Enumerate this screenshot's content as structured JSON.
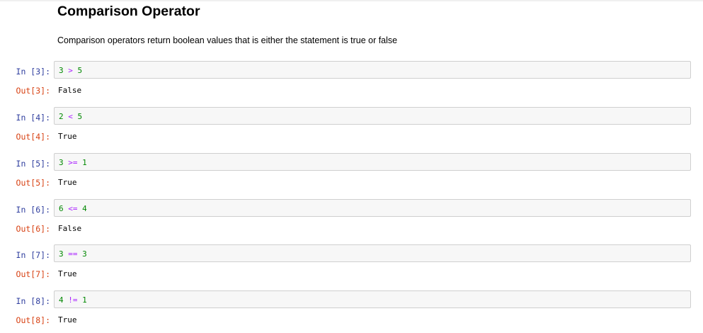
{
  "markdown": {
    "title": "Comparison Operator",
    "description": "Comparison operators return boolean values that is either the statement is true or false"
  },
  "cells": [
    {
      "in_prompt": "In [3]:",
      "left": "3",
      "op": ">",
      "right": "5",
      "out_prompt": "Out[3]:",
      "output": "False"
    },
    {
      "in_prompt": "In [4]:",
      "left": "2",
      "op": "<",
      "right": "5",
      "out_prompt": "Out[4]:",
      "output": "True"
    },
    {
      "in_prompt": "In [5]:",
      "left": "3",
      "op": ">=",
      "right": "1",
      "out_prompt": "Out[5]:",
      "output": "True"
    },
    {
      "in_prompt": "In [6]:",
      "left": "6",
      "op": "<=",
      "right": "4",
      "out_prompt": "Out[6]:",
      "output": "False"
    },
    {
      "in_prompt": "In [7]:",
      "left": "3",
      "op": "==",
      "right": "3",
      "out_prompt": "Out[7]:",
      "output": "True"
    },
    {
      "in_prompt": "In [8]:",
      "left": "4",
      "op": "!=",
      "right": "1",
      "out_prompt": "Out[8]:",
      "output": "True"
    }
  ],
  "colors": {
    "in_prompt": "#303f9f",
    "out_prompt": "#d84315",
    "number": "#008800",
    "operator": "#aa22ff",
    "input_background": "#f7f7f7",
    "input_border": "#cfcfcf"
  }
}
